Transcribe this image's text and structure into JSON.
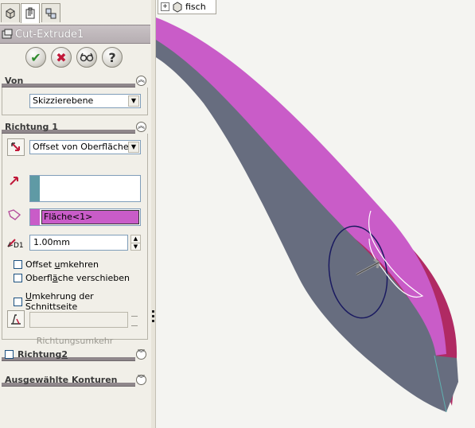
{
  "panel": {
    "title": "Cut-Extrude1",
    "tabs": [
      {
        "name": "feature-manager-tab",
        "icon": "feature-tree-icon"
      },
      {
        "name": "property-manager-tab",
        "icon": "property-manager-icon"
      },
      {
        "name": "configuration-manager-tab",
        "icon": "configuration-icon"
      }
    ],
    "actions": [
      {
        "name": "ok-button",
        "icon": "check-icon",
        "glyph": "✔",
        "color": "#2e8b2e"
      },
      {
        "name": "cancel-button",
        "icon": "close-icon",
        "glyph": "✖",
        "color": "#c0193a"
      },
      {
        "name": "preview-button",
        "icon": "glasses-icon",
        "glyph": "◎",
        "color": "#333333"
      },
      {
        "name": "help-button",
        "icon": "help-icon",
        "glyph": "?",
        "color": "#333333"
      }
    ]
  },
  "von": {
    "title": "Von",
    "select_value": "Skizzierebene"
  },
  "richtung1": {
    "title": "Richtung 1",
    "end_condition": "Offset von Oberfläche",
    "face_value": "Fläche<1>",
    "offset_value": "1.00mm",
    "offset_icon_label": "D1",
    "options": [
      {
        "pre": "Offset ",
        "ul": "u",
        "post": "mkehren"
      },
      {
        "pre": "Oberfl",
        "ul": "ä",
        "post": "che verschieben"
      },
      {
        "pre": "",
        "ul": "U",
        "post": "mkehrung der Schnittseite"
      }
    ],
    "flip_label": "Richtungsumkehr"
  },
  "richtung2": {
    "title_pre": "Richtung ",
    "title_ul": "2"
  },
  "konturen": {
    "title": "Ausgewählte Konturen"
  },
  "tree": {
    "item": "fisch"
  },
  "colors": {
    "face_gray": "#676d7f",
    "face_magenta": "#c95cc8",
    "face_crimson": "#b02a63",
    "selection_magenta": "#c95cc8"
  }
}
